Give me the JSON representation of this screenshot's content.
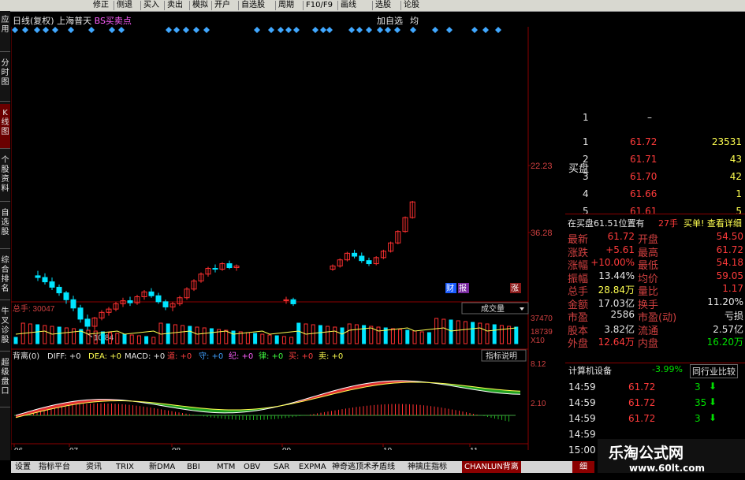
{
  "toolbar": {
    "items": [
      "修正",
      "侧退",
      "买入",
      "卖出",
      "模拟",
      "开户",
      "自选股",
      "周期",
      "F10/F9",
      "画线",
      "选股",
      "论股"
    ]
  },
  "left_tabs": [
    {
      "label": "应用"
    },
    {
      "label": "分时图"
    },
    {
      "label": "K线图"
    },
    {
      "label": "个股资料"
    },
    {
      "label": "自选股"
    },
    {
      "label": "综合排名"
    },
    {
      "label": "牛叉诊股"
    },
    {
      "label": "超级盘口"
    }
  ],
  "chart_header": {
    "period": "日线(复权)",
    "stock": "上海普天",
    "indicator": "BS买卖点",
    "add_watch": "加自选",
    "avg": "均"
  },
  "price_axis": {
    "labels": [
      "36.28",
      "22.23"
    ]
  },
  "low_marker": "10.84",
  "mid_badges": {
    "cai": "财",
    "bao": "报",
    "zhang": "涨"
  },
  "volume_panel": {
    "label": "总手: 30047",
    "dropdown": "成交量",
    "axis": [
      "37470",
      "18739",
      "X10"
    ]
  },
  "macd_panel": {
    "label": "背离(0)",
    "items": [
      {
        "text": "DIFF: +0",
        "color": "#e6e6e6"
      },
      {
        "text": "DEA: +0",
        "color": "#ffff50"
      },
      {
        "text": "MACD: +0",
        "color": "#e6e6e6"
      },
      {
        "text": "道: +0",
        "color": "#ff4040"
      },
      {
        "text": "守: +0",
        "color": "#40a0ff"
      },
      {
        "text": "纪: +0",
        "color": "#ff60ff"
      },
      {
        "text": "律: +0",
        "color": "#40ff40"
      },
      {
        "text": "买: +0",
        "color": "#ff4040"
      },
      {
        "text": "卖: +0",
        "color": "#ffff50"
      }
    ],
    "explain_button": "指标说明",
    "axis": [
      "8.12",
      "2.10"
    ]
  },
  "x_axis": [
    "06",
    "07",
    "08",
    "09",
    "10",
    "11"
  ],
  "chart_data": {
    "type": "candlestick",
    "title": "上海普天 日线(复权)",
    "ylabel": "",
    "y_ticks": [
      22.23,
      36.28
    ],
    "low_annotation": 10.84,
    "x_ticks": [
      "06",
      "07",
      "08",
      "09",
      "10",
      "11"
    ],
    "candles_ohlc": [
      [
        16.2,
        16.8,
        15.6,
        16.0
      ],
      [
        16.0,
        16.5,
        15.2,
        15.5
      ],
      [
        15.5,
        16.0,
        14.6,
        14.9
      ],
      [
        14.9,
        15.2,
        14.0,
        14.3
      ],
      [
        14.3,
        14.5,
        13.2,
        13.6
      ],
      [
        13.6,
        14.0,
        12.5,
        12.8
      ],
      [
        12.8,
        13.1,
        11.5,
        11.8
      ],
      [
        11.8,
        12.2,
        10.84,
        11.2
      ],
      [
        11.2,
        12.0,
        10.9,
        11.9
      ],
      [
        11.9,
        12.6,
        11.7,
        12.4
      ],
      [
        12.4,
        12.9,
        12.1,
        12.7
      ],
      [
        12.7,
        13.4,
        12.5,
        13.2
      ],
      [
        13.2,
        13.8,
        12.9,
        13.5
      ],
      [
        13.5,
        13.9,
        13.0,
        13.3
      ],
      [
        13.3,
        14.1,
        13.1,
        13.9
      ],
      [
        13.9,
        14.6,
        13.6,
        14.4
      ],
      [
        14.4,
        14.8,
        13.8,
        14.0
      ],
      [
        14.0,
        14.3,
        13.2,
        13.4
      ],
      [
        13.4,
        13.6,
        12.6,
        12.9
      ],
      [
        12.9,
        13.4,
        12.5,
        13.2
      ],
      [
        13.2,
        14.0,
        13.0,
        13.8
      ],
      [
        13.8,
        14.9,
        13.6,
        14.7
      ],
      [
        14.7,
        15.8,
        14.5,
        15.6
      ],
      [
        15.6,
        16.6,
        15.4,
        16.4
      ],
      [
        16.4,
        17.3,
        16.1,
        17.1
      ],
      [
        17.1,
        17.6,
        16.6,
        17.0
      ],
      [
        17.0,
        17.9,
        16.8,
        17.7
      ],
      [
        17.7,
        18.1,
        17.0,
        17.2
      ],
      [
        17.2,
        17.6,
        16.8,
        17.4
      ],
      [
        13.5,
        13.9,
        13.2,
        13.6
      ],
      [
        13.6,
        13.8,
        13.0,
        13.2
      ],
      [
        17.0,
        17.6,
        16.8,
        17.4
      ],
      [
        17.4,
        18.4,
        17.2,
        18.2
      ],
      [
        18.2,
        19.3,
        18.0,
        19.1
      ],
      [
        19.1,
        19.6,
        18.4,
        18.7
      ],
      [
        18.7,
        19.2,
        17.8,
        18.1
      ],
      [
        18.1,
        18.5,
        17.4,
        17.7
      ],
      [
        17.7,
        18.7,
        17.5,
        18.5
      ],
      [
        18.5,
        19.6,
        18.3,
        19.4
      ],
      [
        19.4,
        20.8,
        19.2,
        20.6
      ],
      [
        20.6,
        22.6,
        20.4,
        22.4
      ],
      [
        22.4,
        25.0,
        22.2,
        24.8
      ],
      [
        24.8,
        28.0,
        24.6,
        27.8
      ]
    ],
    "volume_axis": [
      18739,
      37470
    ],
    "volume_last": 30047,
    "macd_axis": [
      2.1,
      8.12
    ]
  },
  "quote": {
    "sell_side_label": "",
    "rows_top": [
      {
        "level": "1",
        "price": "–",
        "vol": "",
        "price_color": "#e6e6e6"
      }
    ],
    "buy_label": "买盘",
    "buy_rows": [
      {
        "level": "1",
        "price": "61.72",
        "vol": "23531"
      },
      {
        "level": "2",
        "price": "61.71",
        "vol": "43"
      },
      {
        "level": "3",
        "price": "61.70",
        "vol": "42"
      },
      {
        "level": "4",
        "price": "61.66",
        "vol": "1"
      },
      {
        "level": "5",
        "price": "61.61",
        "vol": "5"
      }
    ],
    "banner": {
      "left": "在买盘61.51位置有",
      "mid": "27手",
      "right": "买单! 查看详细"
    },
    "stats": [
      {
        "l1": "最新",
        "v1": "61.72",
        "c1": "red",
        "l2": "开盘",
        "v2": "54.50",
        "c2": "red"
      },
      {
        "l1": "涨跌",
        "v1": "+5.61",
        "c1": "red",
        "l2": "最高",
        "v2": "61.72",
        "c2": "red"
      },
      {
        "l1": "涨幅",
        "v1": "+10.00%",
        "c1": "red",
        "l2": "最低",
        "v2": "54.18",
        "c2": "red"
      },
      {
        "l1": "振幅",
        "v1": "13.44%",
        "c1": "white",
        "l2": "均价",
        "v2": "59.05",
        "c2": "red"
      },
      {
        "l1": "总手",
        "v1": "28.84万",
        "c1": "yellow",
        "l2": "量比",
        "v2": "1.17",
        "c2": "red"
      },
      {
        "l1": "金额",
        "v1": "17.03亿",
        "c1": "white",
        "l2": "换手",
        "v2": "11.20%",
        "c2": "white"
      },
      {
        "l1": "市盈",
        "v1": "2586",
        "c1": "white",
        "l2": "市盈(动)",
        "v2": "亏损",
        "c2": "white"
      },
      {
        "l1": "股本",
        "v1": "3.82亿",
        "c1": "white",
        "l2": "流通",
        "v2": "2.57亿",
        "c2": "white"
      },
      {
        "l1": "外盘",
        "v1": "12.64万",
        "c1": "red",
        "l2": "内盘",
        "v2": "16.20万",
        "c2": "green"
      }
    ],
    "sector": {
      "name": "计算机设备",
      "change": "-3.99%",
      "compare": "同行业比较"
    },
    "ticks": [
      {
        "time": "14:59",
        "price": "61.72",
        "vol": "3"
      },
      {
        "time": "14:59",
        "price": "61.72",
        "vol": "35"
      },
      {
        "time": "14:59",
        "price": "61.72",
        "vol": "3"
      },
      {
        "time": "14:59",
        "price": "",
        "vol": ""
      },
      {
        "time": "15:00",
        "price": "",
        "vol": ""
      }
    ]
  },
  "bottom_tabs": [
    "设置",
    "指标平台",
    "资讯",
    "TRIX",
    "新DMA",
    "BBI",
    "MTM",
    "OBV",
    "SAR",
    "EXPMA",
    "神奇逃顶术矛盾线",
    "神擒庄指标",
    "CHANLUN背离"
  ],
  "detail_tab": "细",
  "watermark": {
    "title": "乐淘公式网",
    "url": "www.60lt.com"
  },
  "colors": {
    "up": "#ff3030",
    "down": "#00e5ff",
    "macd_red": "#ff3030",
    "macd_green": "#20b020",
    "axis": "#8b0000"
  }
}
